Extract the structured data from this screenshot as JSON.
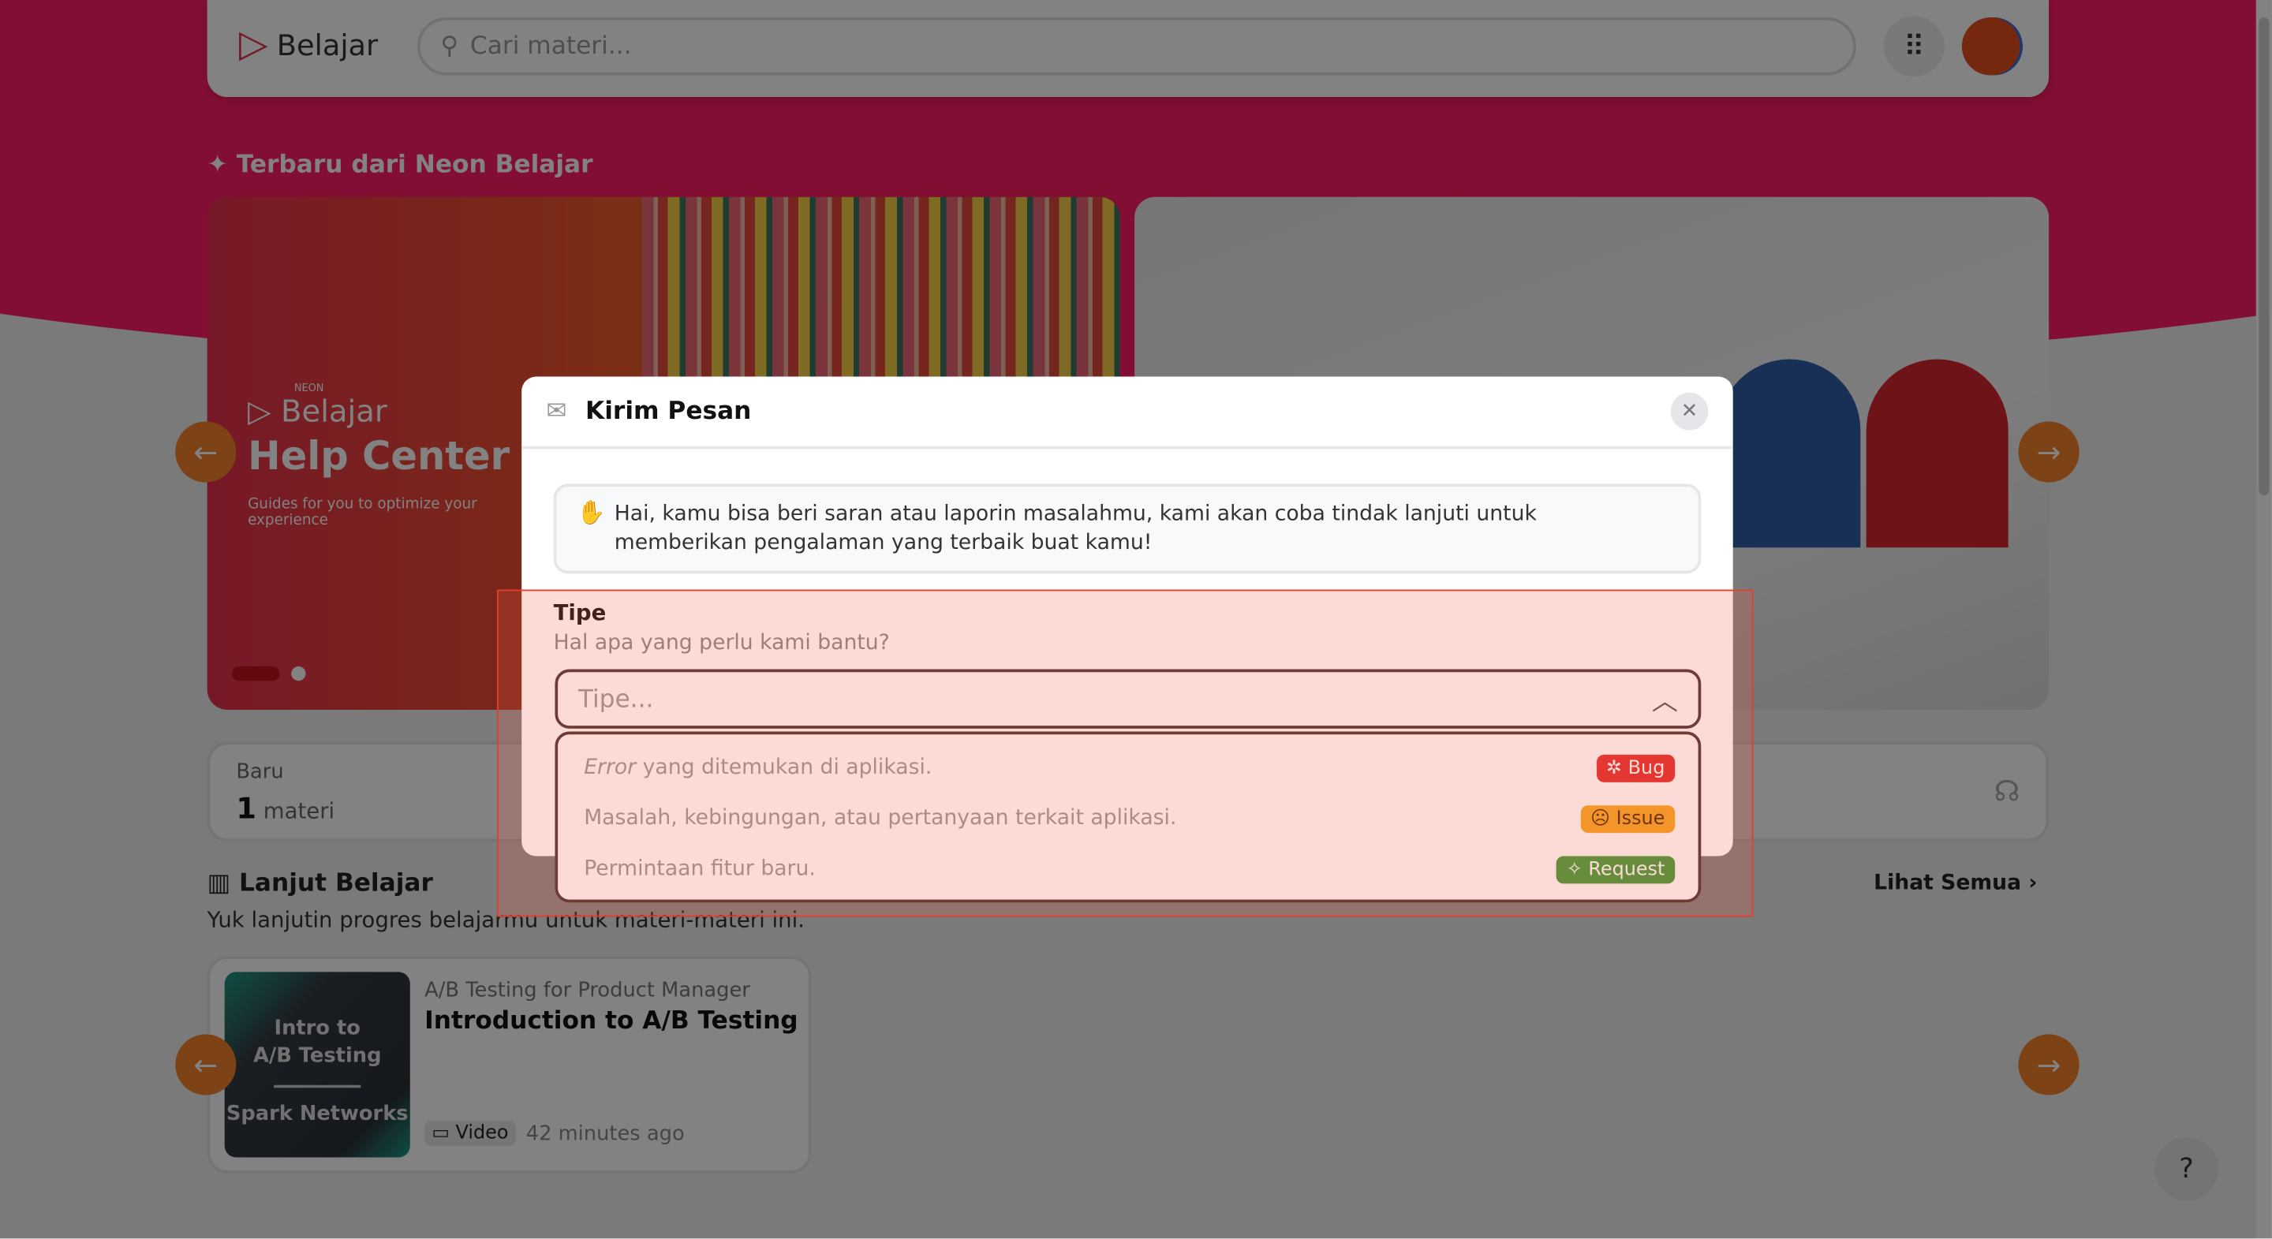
{
  "nav": {
    "brand": "Belajar",
    "search_placeholder": "Cari materi...",
    "icons": {
      "search": "search-icon",
      "apps": "grid-icon",
      "avatar": "user-avatar"
    }
  },
  "latest": {
    "title": "Terbaru dari Neon Belajar",
    "banner": {
      "brand_small": "NEON",
      "brand": "Belajar",
      "title": "Help Center",
      "subtitle": "Guides for you to optimize your experience"
    }
  },
  "stats": {
    "label": "Baru",
    "value": "1",
    "unit": "materi"
  },
  "continue": {
    "title": "Lanjut Belajar",
    "subtitle": "Yuk lanjutin progres belajarmu untuk materi-materi ini.",
    "see_all": "Lihat Semua",
    "course": {
      "thumb_title": "Intro to A/B Testing",
      "thumb_org": "Spark Networks",
      "category": "A/B Testing for Product Manager",
      "title": "Introduction to A/B Testing",
      "type": "Video",
      "time": "42 minutes ago"
    }
  },
  "help_button": "?",
  "modal": {
    "title": "Kirim Pesan",
    "info": "Hai, kamu bisa beri saran atau laporin masalahmu, kami akan coba tindak lanjuti untuk memberikan pengalaman yang terbaik buat kamu!",
    "field_label": "Tipe",
    "field_help": "Hal apa yang perlu kami bantu?",
    "select_placeholder": "Tipe...",
    "options": [
      {
        "em": "Error",
        "text": " yang ditemukan di aplikasi.",
        "badge": "Bug",
        "color": "#e02d2d",
        "icon": "bug-icon"
      },
      {
        "em": "",
        "text": "Masalah, kebingungan, atau pertanyaan terkait aplikasi.",
        "badge": "Issue",
        "color": "#f5a623",
        "icon": "confused-face-icon"
      },
      {
        "em": "",
        "text": "Permintaan fitur baru.",
        "badge": "Request",
        "color": "#3f9a3a",
        "icon": "sparkle-icon"
      }
    ]
  },
  "colors": {
    "brand": "#ff1e64",
    "accent": "#f5822a"
  }
}
